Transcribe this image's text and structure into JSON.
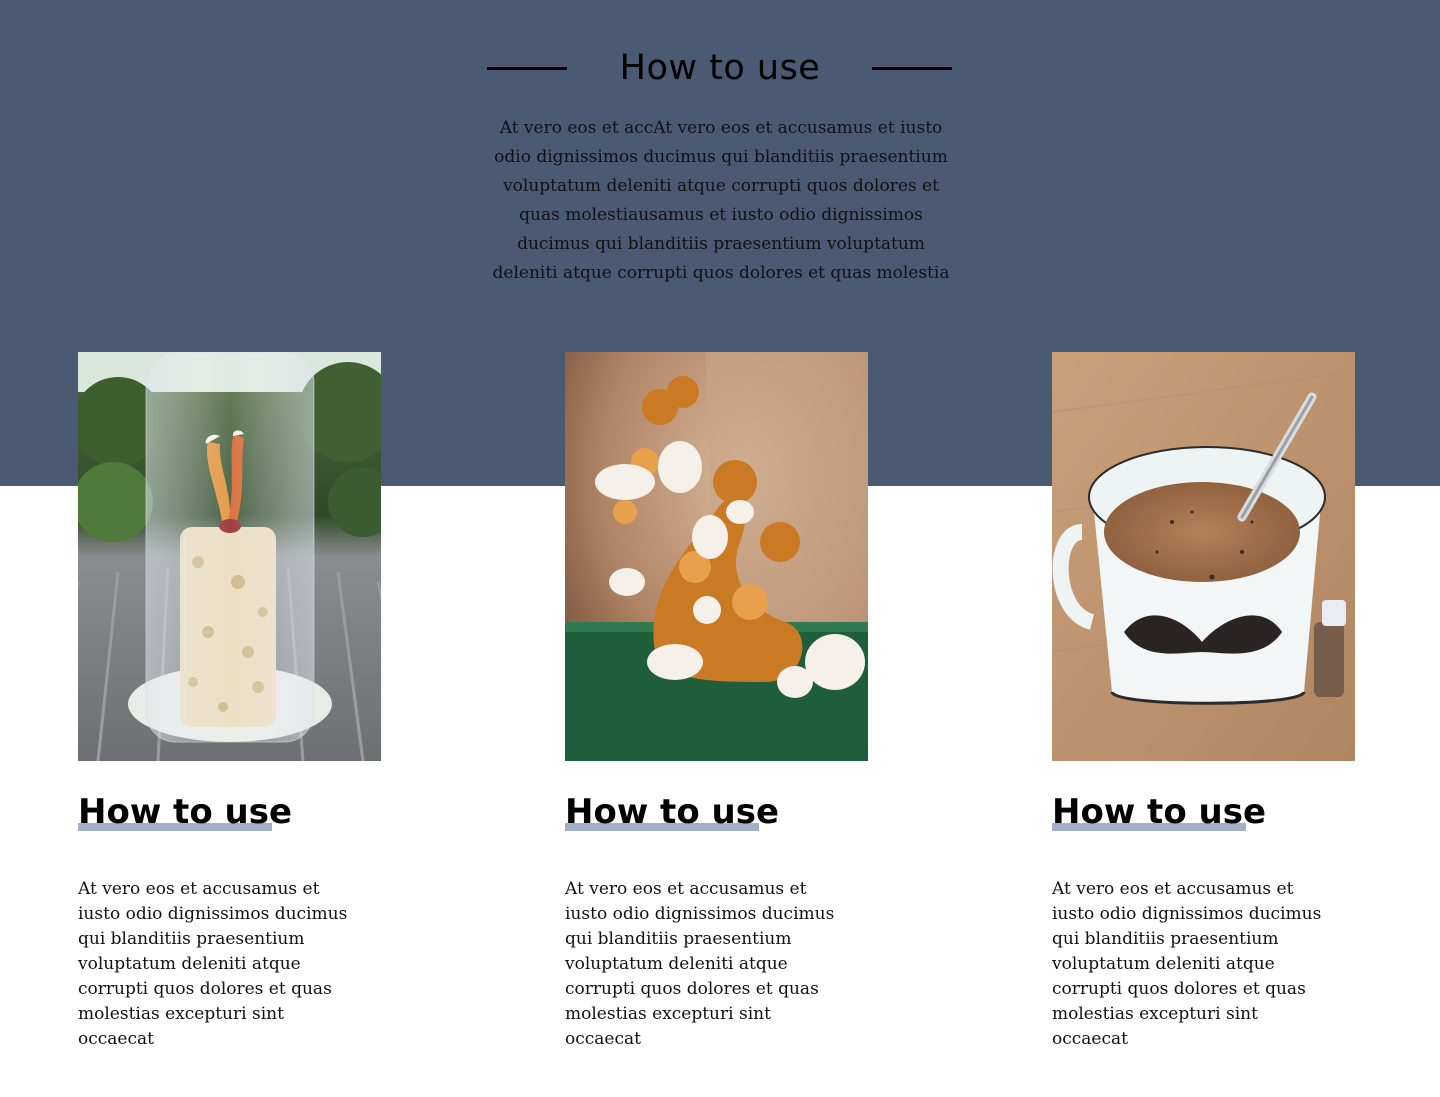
{
  "section": {
    "title": "How to use",
    "intro": "At vero eos et accAt vero eos et accusamus et iusto odio dignissimos ducimus qui blanditiis praesentium voluptatum deleniti atque corrupti quos dolores et quas molestiausamus et iusto odio dignissimos ducimus qui blanditiis praesentium voluptatum deleniti atque corrupti quos dolores et quas molestia"
  },
  "colors": {
    "hero_band": "#4a5a72",
    "title_underline": "#a3b0c6"
  },
  "cards": [
    {
      "image": "mushroom-grow-kit-photo",
      "title": "How to use",
      "body": "At vero eos et accusamus et iusto odio dignissimos ducimus qui blanditiis praesentium voluptatum deleniti atque corrupti quos dolores et quas molestias excepturi sint occaecat"
    },
    {
      "image": "reishi-mushroom-photo",
      "title": "How to use",
      "body": "At vero eos et accusamus et iusto odio dignissimos ducimus qui blanditiis praesentium voluptatum deleniti atque corrupti quos dolores et quas molestias excepturi sint occaecat"
    },
    {
      "image": "coffee-cup-photo",
      "title": "How to use",
      "body": "At vero eos et accusamus et iusto odio dignissimos ducimus qui blanditiis praesentium voluptatum deleniti atque corrupti quos dolores et quas molestias excepturi sint occaecat"
    }
  ]
}
